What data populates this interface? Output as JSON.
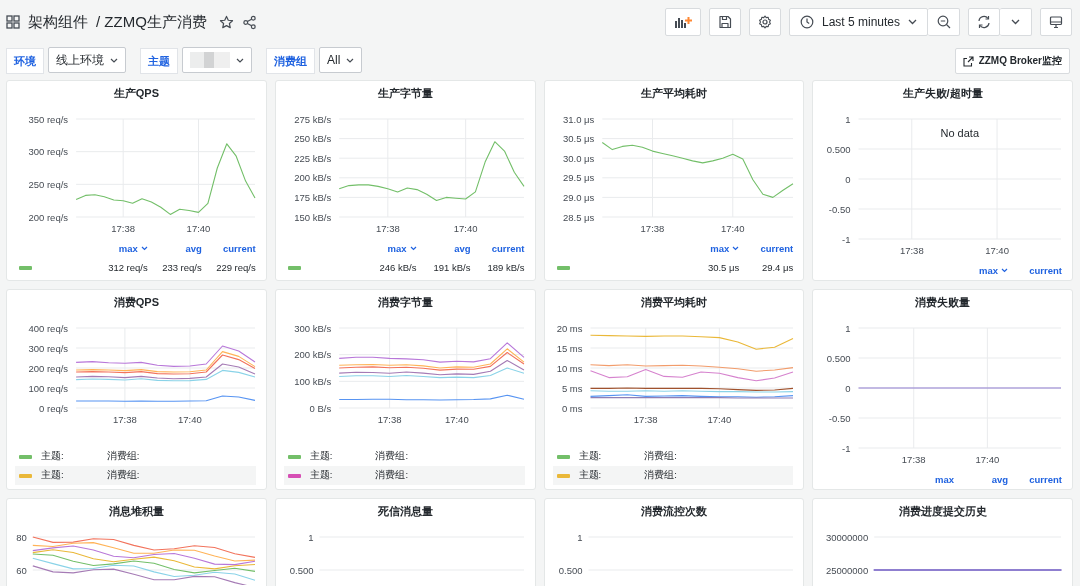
{
  "header": {
    "folder": "架构组件",
    "title": "/ ZZMQ生产消费"
  },
  "toolbar": {
    "time_range": "Last 5 minutes"
  },
  "variables": [
    {
      "label": "环境",
      "value": "线上环境"
    },
    {
      "label": "主题"
    },
    {
      "label": "消费组",
      "value": "All"
    }
  ],
  "links": [
    {
      "label": "ZZMQ Broker监控"
    }
  ],
  "panels": [
    {
      "title": "生产QPS",
      "chart_data": {
        "type": "line",
        "grid": true,
        "categories": [
          null,
          null,
          null,
          null,
          null,
          "17:38",
          null,
          null,
          null,
          null,
          null,
          null,
          null,
          "17:40",
          null,
          null,
          null,
          null,
          null,
          null
        ],
        "ylim": [
          200,
          350
        ],
        "yticks": [
          {
            "value": 200,
            "label": "200 req/s"
          },
          {
            "value": 250,
            "label": "250 req/s"
          },
          {
            "value": 300,
            "label": "300 req/s"
          },
          {
            "value": 350,
            "label": "350 req/s"
          }
        ],
        "series": [
          {
            "color": "#73bf69",
            "values": [
              227,
              233,
              234,
              231,
              226,
              225,
              221,
              228,
              223,
              215,
              204,
              212,
              210,
              207,
              221,
              275,
              312,
              293,
              255,
              229
            ]
          }
        ]
      },
      "legend_columns": [
        {
          "label": "max",
          "sorted": true
        },
        {
          "label": "avg",
          "sorted": false
        },
        {
          "label": "current",
          "sorted": false
        }
      ],
      "legend_items": [
        {
          "color": "#73bf69",
          "values": [
            "312 req/s",
            "233 req/s",
            "229 req/s"
          ]
        }
      ]
    },
    {
      "title": "生产字节量",
      "chart_data": {
        "type": "line",
        "grid": true,
        "categories": [
          null,
          null,
          null,
          null,
          null,
          "17:38",
          null,
          null,
          null,
          null,
          null,
          null,
          null,
          "17:40",
          null,
          null,
          null,
          null,
          null,
          null
        ],
        "ylim": [
          150,
          275
        ],
        "yticks": [
          {
            "value": 150,
            "label": "150 kB/s"
          },
          {
            "value": 175,
            "label": "175 kB/s"
          },
          {
            "value": 200,
            "label": "200 kB/s"
          },
          {
            "value": 225,
            "label": "225 kB/s"
          },
          {
            "value": 250,
            "label": "250 kB/s"
          },
          {
            "value": 275,
            "label": "275 kB/s"
          }
        ],
        "series": [
          {
            "color": "#73bf69",
            "values": [
              186,
              190,
              191,
              191,
              189,
              186,
              182,
              187,
              185,
              179,
              171,
              175,
              174,
              173,
              182,
              220,
              246,
              234,
              207,
              189
            ]
          }
        ]
      },
      "legend_columns": [
        {
          "label": "max",
          "sorted": true
        },
        {
          "label": "avg",
          "sorted": false
        },
        {
          "label": "current",
          "sorted": false
        }
      ],
      "legend_items": [
        {
          "color": "#73bf69",
          "values": [
            "246 kB/s",
            "191 kB/s",
            "189 kB/s"
          ]
        }
      ]
    },
    {
      "title": "生产平均耗时",
      "chart_data": {
        "type": "line",
        "grid": true,
        "categories": [
          null,
          null,
          null,
          null,
          null,
          "17:38",
          null,
          null,
          null,
          null,
          null,
          null,
          null,
          "17:40",
          null,
          null,
          null,
          null,
          null,
          null
        ],
        "ylim": [
          28.5,
          31
        ],
        "yticks": [
          {
            "value": 28.5,
            "label": "28.5 μs"
          },
          {
            "value": 29,
            "label": "29.0 μs"
          },
          {
            "value": 29.5,
            "label": "29.5 μs"
          },
          {
            "value": 30,
            "label": "30.0 μs"
          },
          {
            "value": 30.5,
            "label": "30.5 μs"
          },
          {
            "value": 31,
            "label": "31.0 μs"
          }
        ],
        "series": [
          {
            "color": "#73bf69",
            "values": [
              30.4,
              30.22,
              30.3,
              30.33,
              30.28,
              30.18,
              30.12,
              30.06,
              30.0,
              29.93,
              29.88,
              29.93,
              30.0,
              30.1,
              29.98,
              29.45,
              29.08,
              29.0,
              29.18,
              29.35
            ]
          }
        ]
      },
      "legend_columns": [
        {
          "label": "max",
          "sorted": true
        },
        {
          "label": "current",
          "sorted": false
        }
      ],
      "legend_items": [
        {
          "color": "#73bf69",
          "values": [
            "30.5 μs",
            "29.4 μs"
          ]
        }
      ]
    },
    {
      "title": "生产失败/超时量",
      "no_data": "No data",
      "chart_data": {
        "type": "line",
        "grid": true,
        "categories": [
          null,
          null,
          null,
          null,
          null,
          "17:38",
          null,
          null,
          null,
          null,
          null,
          null,
          null,
          "17:40",
          null,
          null,
          null,
          null,
          null,
          null
        ],
        "ylim": [
          -1,
          1
        ],
        "yticks": [
          {
            "value": -1,
            "label": "-1"
          },
          {
            "value": -0.5,
            "label": "-0.50"
          },
          {
            "value": 0,
            "label": "0"
          },
          {
            "value": 0.5,
            "label": "0.500"
          },
          {
            "value": 1,
            "label": "1"
          }
        ]
      },
      "legend_columns": [
        {
          "label": "max",
          "sorted": true
        },
        {
          "label": "current",
          "sorted": false
        }
      ]
    },
    {
      "title": "消费QPS",
      "chart_data": {
        "type": "line",
        "grid": true,
        "categories": [
          null,
          null,
          null,
          "17:38",
          null,
          null,
          null,
          "17:40",
          null,
          null,
          null,
          null
        ],
        "ylim": [
          0,
          400
        ],
        "yticks": [
          {
            "value": 0,
            "label": "0 req/s"
          },
          {
            "value": 100,
            "label": "100 req/s"
          },
          {
            "value": 200,
            "label": "200 req/s"
          },
          {
            "value": 300,
            "label": "300 req/s"
          },
          {
            "value": 400,
            "label": "400 req/s"
          }
        ],
        "series": [
          {
            "color": "#b877d9",
            "values": [
              228,
              232,
              226,
              224,
              228,
              214,
              208,
              210,
              220,
              310,
              285,
              230
            ]
          },
          {
            "color": "#ffb357",
            "values": [
              190,
              192,
              190,
              187,
              192,
              182,
              180,
              181,
              190,
              282,
              258,
              207
            ]
          },
          {
            "color": "#f2735c",
            "values": [
              180,
              182,
              180,
              177,
              182,
              172,
              170,
              171,
              180,
              265,
              242,
              198
            ]
          },
          {
            "color": "#a57bb5",
            "values": [
              155,
              158,
              156,
              152,
              158,
              150,
              146,
              148,
              155,
              220,
              205,
              170
            ]
          },
          {
            "color": "#8ad3e8",
            "values": [
              142,
              145,
              143,
              140,
              146,
              138,
              136,
              137,
              143,
              188,
              178,
              155
            ]
          },
          {
            "color": "#5794f2",
            "values": [
              35,
              35,
              35,
              34,
              35,
              34,
              34,
              35,
              36,
              60,
              55,
              38
            ]
          }
        ]
      },
      "legend_items": [
        {
          "color": "#73bf69",
          "topic_label": "主题:",
          "group_label": "消费组:"
        },
        {
          "color": "#eab839",
          "topic_label": "主题:",
          "group_label": "消费组:"
        }
      ]
    },
    {
      "title": "消费字节量",
      "chart_data": {
        "type": "line",
        "grid": true,
        "categories": [
          null,
          null,
          null,
          "17:38",
          null,
          null,
          null,
          "17:40",
          null,
          null,
          null,
          null
        ],
        "ylim": [
          0,
          300
        ],
        "yticks": [
          {
            "value": 0,
            "label": "0 B/s"
          },
          {
            "value": 100,
            "label": "100 kB/s"
          },
          {
            "value": 200,
            "label": "200 kB/s"
          },
          {
            "value": 300,
            "label": "300 kB/s"
          }
        ],
        "series": [
          {
            "color": "#b877d9",
            "values": [
              186,
              190,
              190,
              186,
              184,
              181,
              172,
              175,
              173,
              185,
              244,
              190
            ]
          },
          {
            "color": "#ffb357",
            "values": [
              160,
              162,
              163,
              160,
              162,
              158,
              150,
              154,
              153,
              165,
              222,
              172
            ]
          },
          {
            "color": "#f2735c",
            "values": [
              150,
              153,
              154,
              151,
              153,
              149,
              142,
              146,
              145,
              156,
              208,
              165
            ]
          },
          {
            "color": "#a57bb5",
            "values": [
              131,
              134,
              133,
              130,
              135,
              131,
              125,
              128,
              126,
              138,
              178,
              142
            ]
          },
          {
            "color": "#8ad3e8",
            "values": [
              118,
              121,
              121,
              118,
              122,
              118,
              114,
              116,
              114,
              122,
              150,
              130
            ]
          },
          {
            "color": "#5794f2",
            "values": [
              32,
              32,
              33,
              33,
              31,
              31,
              30,
              31,
              32,
              34,
              48,
              33
            ]
          }
        ]
      },
      "legend_items": [
        {
          "color": "#73bf69",
          "topic_label": "主题:",
          "group_label": "消费组:"
        },
        {
          "color": "#d64fb4",
          "topic_label": "主题:",
          "group_label": "消费组:"
        }
      ]
    },
    {
      "title": "消费平均耗时",
      "chart_data": {
        "type": "line",
        "grid": true,
        "categories": [
          null,
          null,
          null,
          "17:38",
          null,
          null,
          null,
          "17:40",
          null,
          null,
          null,
          null
        ],
        "ylim": [
          0,
          20
        ],
        "yticks": [
          {
            "value": 0,
            "label": "0 ms"
          },
          {
            "value": 5,
            "label": "5 ms"
          },
          {
            "value": 10,
            "label": "10 ms"
          },
          {
            "value": 15,
            "label": "15 ms"
          },
          {
            "value": 20,
            "label": "20 ms"
          }
        ],
        "series": [
          {
            "color": "#eab839",
            "values": [
              18.2,
              18.1,
              18.0,
              17.9,
              18.0,
              18.0,
              17.8,
              17.6,
              16.5,
              14.7,
              15.2,
              17.4
            ]
          },
          {
            "color": "#f29c6b",
            "values": [
              10.8,
              10.6,
              10.8,
              10.5,
              10.6,
              10.7,
              10.5,
              10.2,
              9.8,
              9.2,
              9.5,
              10.1
            ]
          },
          {
            "color": "#d683ce",
            "values": [
              9.3,
              7.6,
              7.8,
              9.6,
              7.9,
              7.7,
              9.0,
              8.7,
              7.6,
              6.8,
              7.5,
              9.0
            ]
          },
          {
            "color": "#a0522d",
            "values": [
              4.9,
              4.9,
              5.0,
              4.9,
              4.9,
              4.9,
              4.9,
              4.8,
              4.6,
              4.4,
              4.5,
              4.9
            ]
          },
          {
            "color": "#8ad3e8",
            "values": [
              4.3,
              4.2,
              4.2,
              4.3,
              4.2,
              4.3,
              4.2,
              4.1,
              4.1,
              4.0,
              4.0,
              4.1
            ]
          },
          {
            "color": "#5794f2",
            "values": [
              2.9,
              3.1,
              3.3,
              2.9,
              3.0,
              3.1,
              2.9,
              2.8,
              2.8,
              2.7,
              2.8,
              3.1
            ]
          },
          {
            "color": "#8f7fb5",
            "values": [
              2.6,
              2.6,
              2.6,
              2.6,
              2.6,
              2.6,
              2.6,
              2.6,
              2.5,
              2.5,
              2.5,
              2.5
            ]
          }
        ]
      },
      "legend_items": [
        {
          "color": "#73bf69",
          "topic_label": "主题:",
          "group_label": "消费组:"
        },
        {
          "color": "#eab839",
          "topic_label": "主题:",
          "group_label": "消费组:"
        }
      ]
    },
    {
      "title": "消费失败量",
      "chart_data": {
        "type": "line",
        "grid": true,
        "categories": [
          null,
          null,
          null,
          "17:38",
          null,
          null,
          null,
          "17:40",
          null,
          null,
          null,
          null
        ],
        "ylim": [
          -1,
          1
        ],
        "yticks": [
          {
            "value": -1,
            "label": "-1"
          },
          {
            "value": -0.5,
            "label": "-0.50"
          },
          {
            "value": 0,
            "label": "0"
          },
          {
            "value": 0.5,
            "label": "0.500"
          },
          {
            "value": 1,
            "label": "1"
          }
        ],
        "series": [
          {
            "color": "#8f7fd0",
            "values": [
              0,
              0,
              0,
              0,
              0,
              0,
              0,
              0,
              0,
              0,
              0,
              0
            ]
          }
        ]
      },
      "legend_columns": [
        {
          "label": "max",
          "sorted": false
        },
        {
          "label": "avg",
          "sorted": false
        },
        {
          "label": "current",
          "sorted": false
        }
      ]
    },
    {
      "title": "消息堆积量",
      "axis_labels": [
        "80",
        "60"
      ],
      "lines": [
        {
          "color": "#f2735c"
        },
        {
          "color": "#ffb357"
        },
        {
          "color": "#b877d9"
        },
        {
          "color": "#eab839"
        },
        {
          "color": "#73bf69"
        },
        {
          "color": "#8ad3e8"
        },
        {
          "color": "#a57bb5"
        }
      ]
    },
    {
      "title": "死信消息量",
      "axis_labels": [
        "1",
        "0.500"
      ]
    },
    {
      "title": "消费流控次数",
      "axis_labels": [
        "1",
        "0.500"
      ]
    },
    {
      "title": "消费进度提交历史",
      "axis_labels": [
        "30000000",
        "25000000"
      ],
      "lines": [
        {
          "color": "#8f7fd0"
        }
      ]
    }
  ]
}
